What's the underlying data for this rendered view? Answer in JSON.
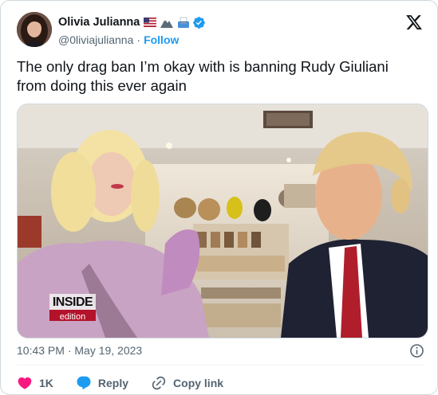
{
  "author": {
    "display_name": "Olivia Julianna",
    "handle": "@0liviajulianna",
    "separator": "·",
    "follow_label": "Follow",
    "badge_emojis": [
      "us-flag-emoji",
      "mountain-emoji",
      "ballot-box-emoji"
    ],
    "verified_color": "#1d9bf0"
  },
  "tweet": {
    "text_line1": "The only drag ban I’m okay with is banning Rudy Giuliani",
    "text_line2": "from doing this ever again"
  },
  "media": {
    "watermark_line1": "INSIDE",
    "watermark_line2": "edition"
  },
  "meta": {
    "timestamp": "10:43 PM · May 19, 2023"
  },
  "actions": {
    "like_count": "1K",
    "reply_label": "Reply",
    "copy_link_label": "Copy link",
    "like_color": "#f91880",
    "reply_color": "#1d9bf0"
  }
}
